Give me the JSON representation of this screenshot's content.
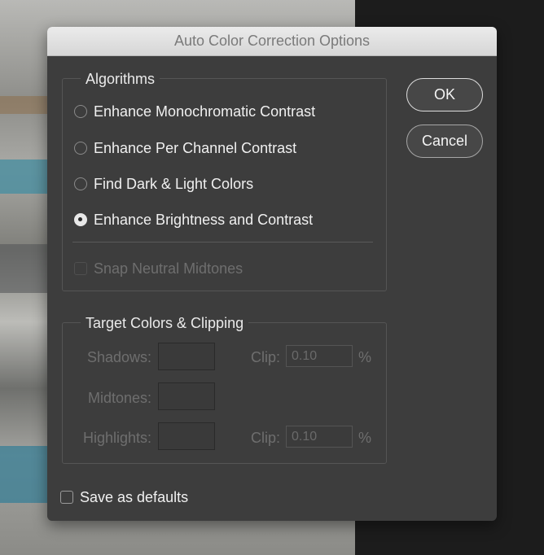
{
  "dialog": {
    "title": "Auto Color Correction Options"
  },
  "algorithms": {
    "title": "Algorithms",
    "options": [
      {
        "label": "Enhance Monochromatic Contrast",
        "selected": false
      },
      {
        "label": "Enhance Per Channel Contrast",
        "selected": false
      },
      {
        "label": "Find Dark & Light Colors",
        "selected": false
      },
      {
        "label": "Enhance Brightness and Contrast",
        "selected": true
      }
    ],
    "snap_label": "Snap Neutral Midtones",
    "snap_checked": false,
    "snap_enabled": false
  },
  "target": {
    "title": "Target Colors & Clipping",
    "shadows_label": "Shadows:",
    "midtones_label": "Midtones:",
    "highlights_label": "Highlights:",
    "clip_label": "Clip:",
    "shadows_clip": "0.10",
    "highlights_clip": "0.10",
    "percent": "%"
  },
  "buttons": {
    "ok": "OK",
    "cancel": "Cancel"
  },
  "save_defaults": {
    "label": "Save as defaults",
    "checked": false
  },
  "colors": {
    "dialog_bg": "#3d3d3d",
    "titlebar_bg": "#e0e0e0",
    "disabled_text": "#6e6e6e"
  }
}
